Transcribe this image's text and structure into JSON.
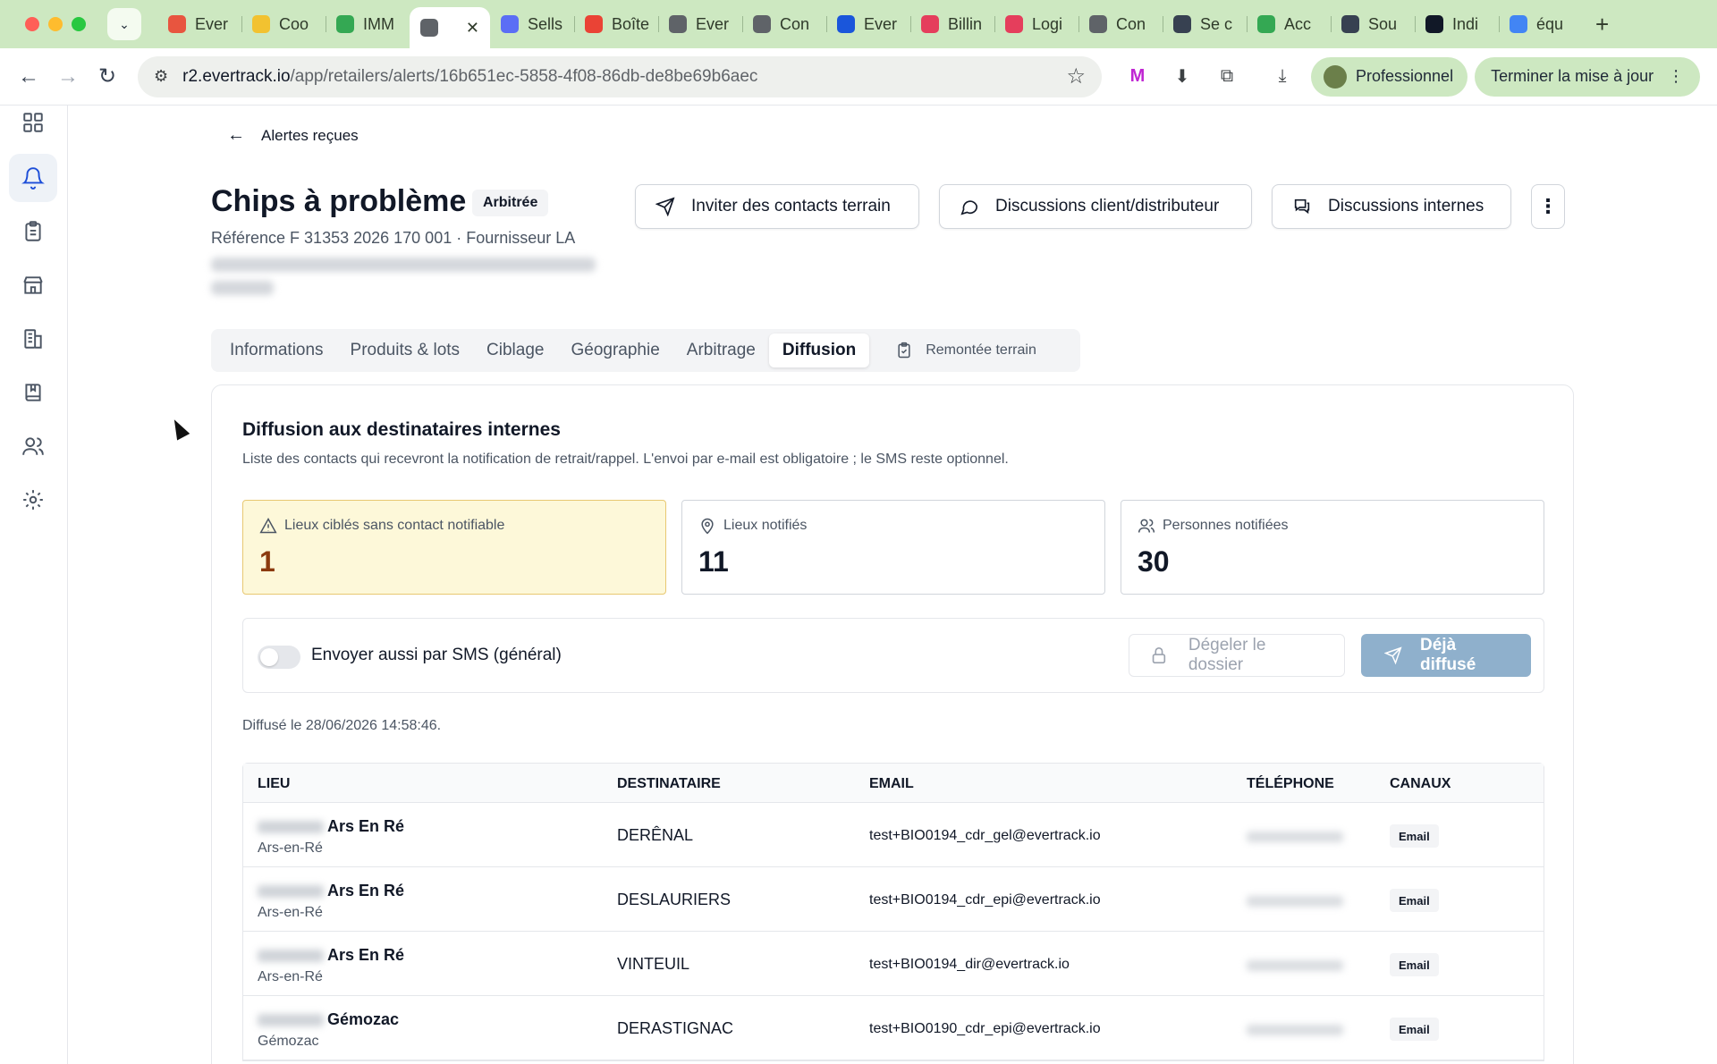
{
  "browser": {
    "tabs": [
      {
        "label": "Ever",
        "color": "#e8553f"
      },
      {
        "label": "Coo",
        "color": "#f2c230"
      },
      {
        "label": "IMM",
        "color": "#34a853"
      },
      {
        "label": "",
        "color": "#5f6368",
        "active": true
      },
      {
        "label": "Sells",
        "color": "#5b6ef5"
      },
      {
        "label": "Boîte",
        "color": "#ea4335"
      },
      {
        "label": "Ever",
        "color": "#5f6368"
      },
      {
        "label": "Con",
        "color": "#5f6368"
      },
      {
        "label": "Ever",
        "color": "#1a56db"
      },
      {
        "label": "Billin",
        "color": "#e53e5c"
      },
      {
        "label": "Logi",
        "color": "#e53e5c"
      },
      {
        "label": "Con",
        "color": "#5f6368"
      },
      {
        "label": "Se c",
        "color": "#374151"
      },
      {
        "label": "Acc",
        "color": "#34a853"
      },
      {
        "label": "Sou",
        "color": "#374151"
      },
      {
        "label": "Indi",
        "color": "#111827"
      },
      {
        "label": "équ",
        "color": "#4285f4"
      }
    ],
    "new_tab": "+",
    "url_host": "r2.evertrack.io",
    "url_path": "/app/retailers/alerts/16b651ec-5858-4f08-86db-de8be69b6aec",
    "profile": "Professionnel",
    "update": "Terminer la mise à jour"
  },
  "back": {
    "label": "Alertes reçues"
  },
  "alert": {
    "title": "Chips à problème",
    "status": "Arbitrée",
    "reference": "Référence F 31353 2026 170 001 · Fournisseur LA"
  },
  "actions": {
    "invite": "Inviter des contacts terrain",
    "client_discussions": "Discussions client/distributeur",
    "internal_discussions": "Discussions internes",
    "more": "⋮"
  },
  "page_tabs": [
    {
      "label": "Informations"
    },
    {
      "label": "Produits & lots"
    },
    {
      "label": "Ciblage"
    },
    {
      "label": "Géographie"
    },
    {
      "label": "Arbitrage"
    },
    {
      "label": "Diffusion",
      "active": true
    },
    {
      "label": "Remontée terrain"
    }
  ],
  "diffusion": {
    "title": "Diffusion aux destinataires internes",
    "description": "Liste des contacts qui recevront la notification de retrait/rappel. L'envoi par e-mail est obligatoire ; le SMS reste optionnel.",
    "stats": [
      {
        "label": "Lieux ciblés sans contact notifiable",
        "value": "1",
        "icon": "warning-icon"
      },
      {
        "label": "Lieux notifiés",
        "value": "11",
        "icon": "map-pin-icon"
      },
      {
        "label": "Personnes notifiées",
        "value": "30",
        "icon": "users-icon"
      }
    ],
    "sms_label": "Envoyer aussi par SMS (général)",
    "thaw_button": "Dégeler le dossier",
    "diffuse_button": "Déjà diffusé",
    "diffused_on": "Diffusé le 28/06/2026 14:58:46."
  },
  "table": {
    "headers": {
      "lieu": "LIEU",
      "destinataire": "DESTINATAIRE",
      "email": "EMAIL",
      "telephone": "TÉLÉPHONE",
      "canaux": "CANAUX"
    },
    "rows": [
      {
        "lieu": "Ars En Ré",
        "ville": "Ars-en-Ré",
        "destinataire": "DERÊNAL",
        "email": "test+BIO0194_cdr_gel@evertrack.io",
        "canal": "Email"
      },
      {
        "lieu": "Ars En Ré",
        "ville": "Ars-en-Ré",
        "destinataire": "DESLAURIERS",
        "email": "test+BIO0194_cdr_epi@evertrack.io",
        "canal": "Email"
      },
      {
        "lieu": "Ars En Ré",
        "ville": "Ars-en-Ré",
        "destinataire": "VINTEUIL",
        "email": "test+BIO0194_dir@evertrack.io",
        "canal": "Email"
      },
      {
        "lieu": "Gémozac",
        "ville": "Gémozac",
        "destinataire": "DERASTIGNAC",
        "email": "test+BIO0190_cdr_epi@evertrack.io",
        "canal": "Email"
      }
    ]
  }
}
